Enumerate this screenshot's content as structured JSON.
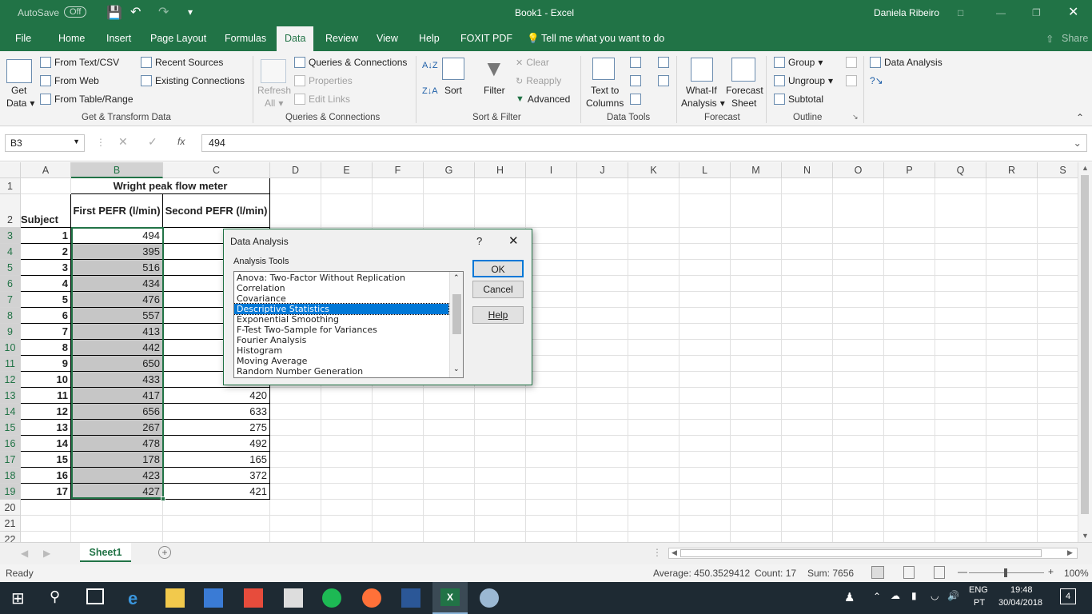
{
  "titlebar": {
    "autosave": "AutoSave",
    "autosave_state": "Off",
    "title": "Book1  -  Excel",
    "user": "Daniela Ribeiro"
  },
  "tabs": [
    "File",
    "Home",
    "Insert",
    "Page Layout",
    "Formulas",
    "Data",
    "Review",
    "View",
    "Help",
    "FOXIT PDF"
  ],
  "tellme": "Tell me what you want to do",
  "share": "Share",
  "ribbon": {
    "get_data": "Get\nData",
    "get_data_l1": "Get",
    "get_data_l2": "Data",
    "from_text": "From Text/CSV",
    "from_web": "From Web",
    "from_table": "From Table/Range",
    "recent_sources": "Recent Sources",
    "existing_connections": "Existing Connections",
    "group1": "Get & Transform Data",
    "refresh_l1": "Refresh",
    "refresh_l2": "All",
    "queries": "Queries & Connections",
    "properties": "Properties",
    "edit_links": "Edit Links",
    "group2": "Queries & Connections",
    "sort": "Sort",
    "filter": "Filter",
    "clear": "Clear",
    "reapply": "Reapply",
    "advanced": "Advanced",
    "group3": "Sort & Filter",
    "text_cols_l1": "Text to",
    "text_cols_l2": "Columns",
    "group4": "Data Tools",
    "whatif_l1": "What-If",
    "whatif_l2": "Analysis",
    "forecast_l1": "Forecast",
    "forecast_l2": "Sheet",
    "group5": "Forecast",
    "group_btn": "Group",
    "ungroup_btn": "Ungroup",
    "subtotal": "Subtotal",
    "group6": "Outline",
    "data_analysis": "Data Analysis"
  },
  "formula": {
    "namebox": "B3",
    "fx": "fx",
    "value": "494"
  },
  "columns": [
    "A",
    "B",
    "C",
    "D",
    "E",
    "F",
    "G",
    "H",
    "I",
    "J",
    "K",
    "L",
    "M",
    "N",
    "O",
    "P",
    "Q",
    "R",
    "S"
  ],
  "rows": [
    "1",
    "2",
    "3",
    "4",
    "5",
    "6",
    "7",
    "8",
    "9",
    "10",
    "11",
    "12",
    "13",
    "14",
    "15",
    "16",
    "17",
    "18",
    "19",
    "20",
    "21",
    "22"
  ],
  "sheet": {
    "header_merged": "Wright peak flow meter",
    "col_a_header": "Subject",
    "col_b_header": "First PEFR (l/min)",
    "col_c_header": "Second PEFR (l/min)",
    "subjects": [
      "1",
      "2",
      "3",
      "4",
      "5",
      "6",
      "7",
      "8",
      "9",
      "10",
      "11",
      "12",
      "13",
      "14",
      "15",
      "16",
      "17"
    ],
    "first": [
      "494",
      "395",
      "516",
      "434",
      "476",
      "557",
      "413",
      "442",
      "650",
      "433",
      "417",
      "656",
      "267",
      "478",
      "178",
      "423",
      "427"
    ],
    "second": [
      "",
      "",
      "",
      "",
      "",
      "",
      "",
      "",
      "",
      "",
      "420",
      "633",
      "275",
      "492",
      "165",
      "372",
      "421"
    ]
  },
  "sheet_tab": "Sheet1",
  "status": {
    "ready": "Ready",
    "average": "Average: 450.3529412",
    "count": "Count: 17",
    "sum": "Sum: 7656",
    "zoom": "100%"
  },
  "dialog": {
    "title": "Data Analysis",
    "help_mark": "?",
    "label": "Analysis Tools",
    "items": [
      "Anova: Two-Factor Without Replication",
      "Correlation",
      "Covariance",
      "Descriptive Statistics",
      "Exponential Smoothing",
      "F-Test Two-Sample for Variances",
      "Fourier Analysis",
      "Histogram",
      "Moving Average",
      "Random Number Generation"
    ],
    "selected": "Descriptive Statistics",
    "ok": "OK",
    "cancel": "Cancel",
    "help": "Help"
  },
  "taskbar": {
    "lang1": "ENG",
    "lang2": "PT",
    "time": "19:48",
    "date": "30/04/2018",
    "notif": "4"
  }
}
